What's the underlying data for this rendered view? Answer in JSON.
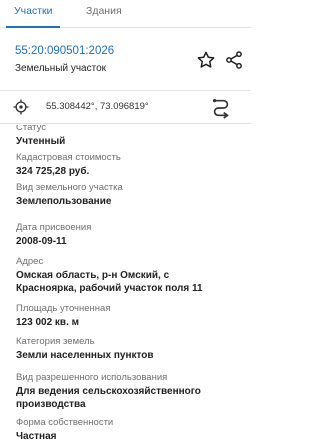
{
  "tabs": [
    {
      "label": "Участки",
      "active": true
    },
    {
      "label": "Здания",
      "active": false
    }
  ],
  "parcel": {
    "cadastral_number": "55:20:090501:2026",
    "object_type": "Земельный участок"
  },
  "toolbar": {
    "favorite_icon": "star-icon",
    "share_icon": "share-icon"
  },
  "location": {
    "coords": "55.308442°, 73.096819°",
    "locate_icon": "crosshair-icon",
    "route_icon": "route-icon"
  },
  "fields": [
    {
      "label": "Статус",
      "value": "Учтенный"
    },
    {
      "label": "Кадастровая стоимость",
      "value": "324 725,28 руб."
    },
    {
      "label": "Вид земельного участка",
      "value": "Землепользование"
    },
    {
      "label": "Дата присвоения",
      "value": "2008-09-11"
    },
    {
      "label": "Адрес",
      "value_lines": [
        "Омская область, р-н Омский, с",
        "Красноярка, рабочий участок поля  11"
      ]
    },
    {
      "label": "Площадь уточненная",
      "value": "123 002 кв. м"
    },
    {
      "label": "Категория земель",
      "value": "Земли населенных пунктов"
    },
    {
      "label": "Вид разрешенного использования",
      "value_lines": [
        "Для ведения сельскохозяйственного",
        "производства"
      ]
    },
    {
      "label": "Форма собственности",
      "value": "Частная"
    }
  ],
  "colors": {
    "accent": "#2170b8",
    "text": "#222222",
    "muted": "#6f6f6f"
  }
}
